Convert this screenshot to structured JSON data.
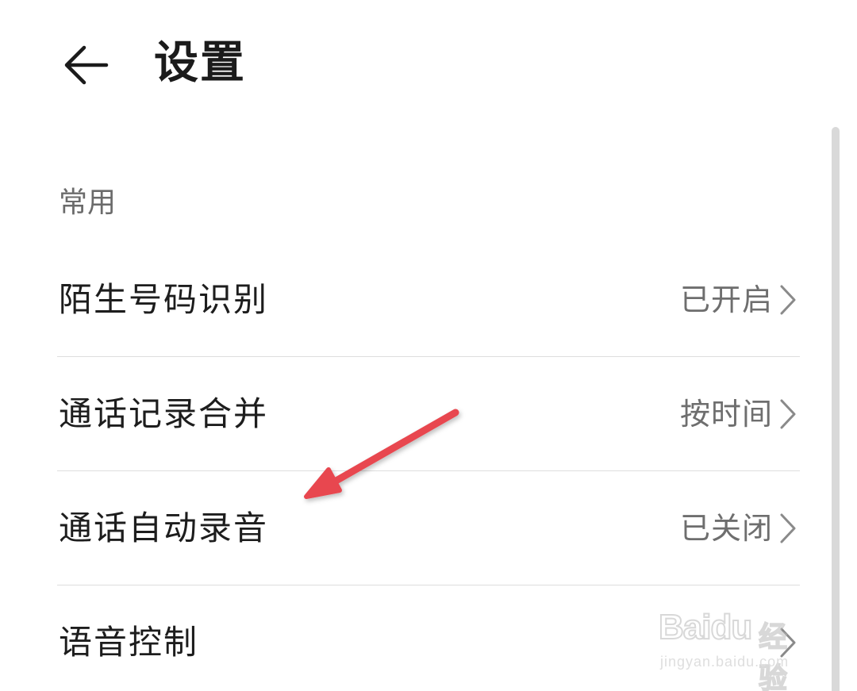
{
  "header": {
    "back_icon": "arrow-left-icon",
    "title": "设置"
  },
  "section": {
    "label": "常用"
  },
  "items": [
    {
      "label": "陌生号码识别",
      "value": "已开启",
      "icon": "chevron-right-icon"
    },
    {
      "label": "通话记录合并",
      "value": "按时间",
      "icon": "chevron-right-icon"
    },
    {
      "label": "通话自动录音",
      "value": "已关闭",
      "icon": "chevron-right-icon"
    },
    {
      "label": "语音控制",
      "value": "",
      "icon": "chevron-right-icon"
    }
  ],
  "annotation": {
    "arrow_color": "#e8474f",
    "points_to": "通话自动录音"
  },
  "watermark": {
    "logo": "Baidu",
    "cn": "经验",
    "url": "jingyan.baidu.com"
  },
  "colors": {
    "title": "#1b1b1b",
    "section_label": "#6b6b6b",
    "value_text": "#6e6e6e",
    "divider": "#dedede",
    "scrollbar": "#d9d9d9"
  }
}
